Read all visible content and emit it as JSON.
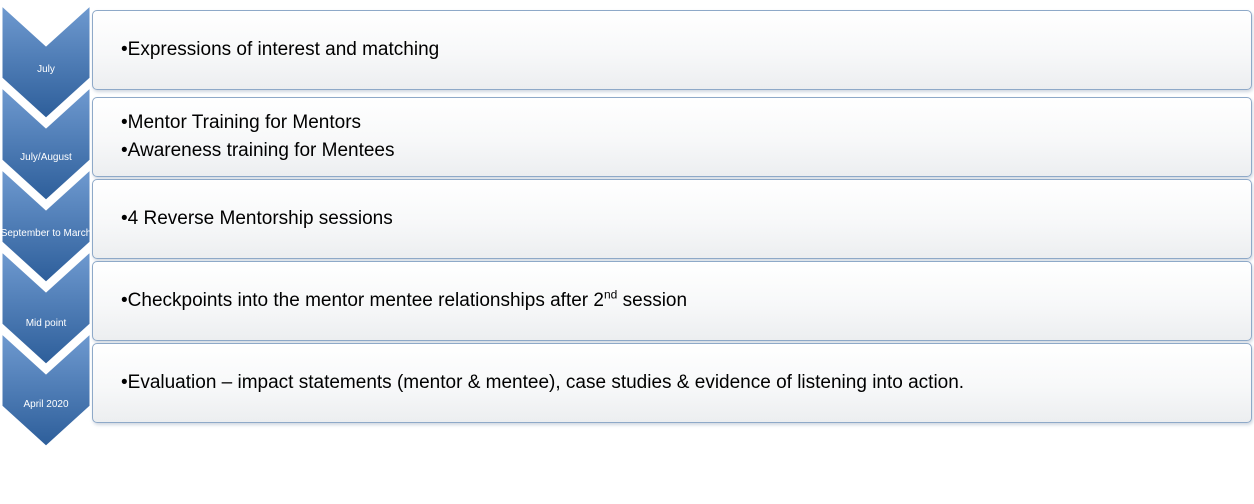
{
  "colors": {
    "chevron_top": "#6f9ad0",
    "chevron_bottom": "#2d5e9a",
    "box_border": "#8ea9c8",
    "text": "#000000",
    "label_text": "#ffffff"
  },
  "stages": [
    {
      "label": "July",
      "items": [
        {
          "text": "•Expressions of interest and matching"
        }
      ]
    },
    {
      "label": "July/August",
      "items": [
        {
          "text": "•Mentor Training for Mentors"
        },
        {
          "text": "•Awareness training for Mentees"
        }
      ]
    },
    {
      "label": "September to March",
      "items": [
        {
          "text": "•4 Reverse Mentorship sessions"
        }
      ]
    },
    {
      "label": "Mid point",
      "items": [
        {
          "text": "•Checkpoints into the mentor mentee relationships after 2",
          "sup": "nd",
          "after": " session"
        }
      ]
    },
    {
      "label": "April 2020",
      "items": [
        {
          "text": "•Evaluation – impact statements (mentor & mentee), case studies & evidence of listening into action."
        }
      ]
    }
  ]
}
